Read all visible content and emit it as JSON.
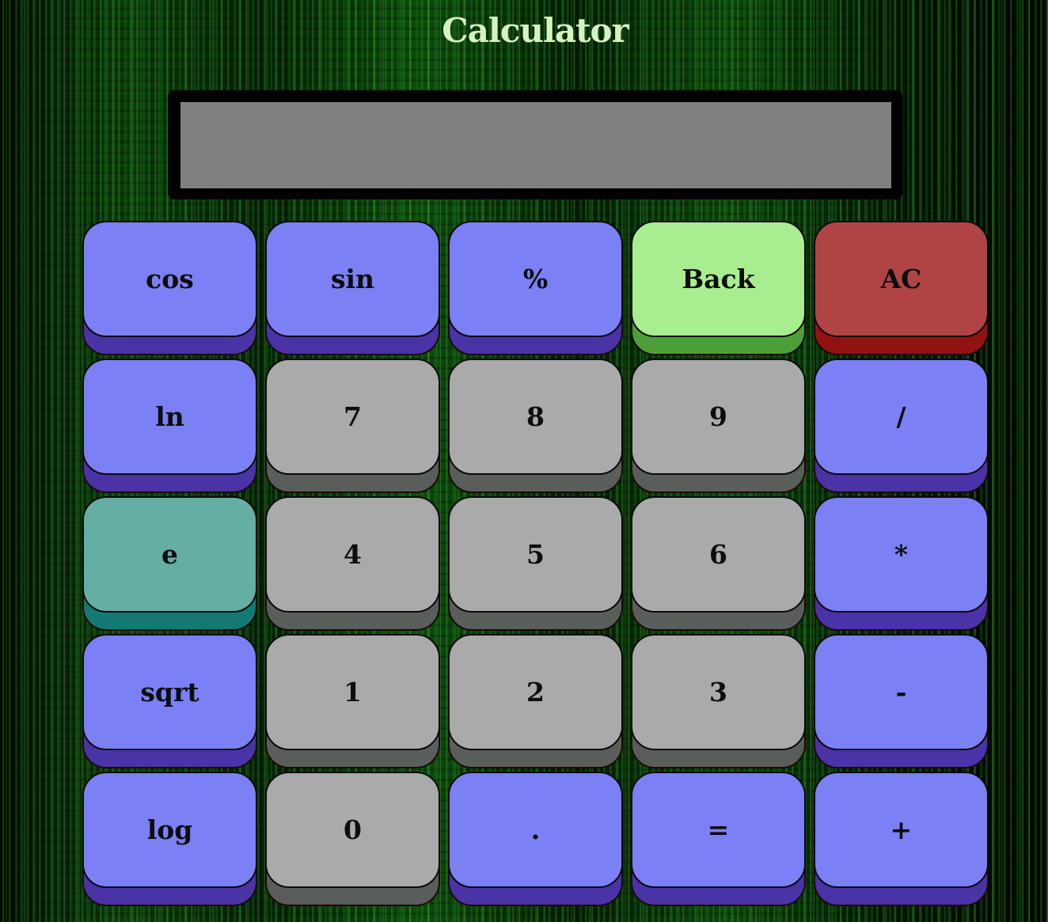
{
  "title": "Calculator",
  "display": {
    "value": ""
  },
  "colors": {
    "blue_face": "#7b80f4",
    "blue_base": "#4a33a6",
    "gray_face": "#aaaaaa",
    "gray_base": "#5a5e5a",
    "green_face": "#a8ee90",
    "green_base": "#4c9f38",
    "red_face": "#b04444",
    "red_base": "#921212",
    "teal_face": "#64aea4",
    "teal_base": "#127a72",
    "display_bg": "#808080",
    "title": "#d6f2c0"
  },
  "keys": {
    "cos": "cos",
    "sin": "sin",
    "percent": "%",
    "back": "Back",
    "ac": "AC",
    "ln": "ln",
    "seven": "7",
    "eight": "8",
    "nine": "9",
    "divide": "/",
    "e": "e",
    "four": "4",
    "five": "5",
    "six": "6",
    "multiply": "*",
    "sqrt": "sqrt",
    "one": "1",
    "two": "2",
    "three": "3",
    "minus": "-",
    "log": "log",
    "zero": "0",
    "decimal": ".",
    "equals": "=",
    "plus": "+"
  }
}
